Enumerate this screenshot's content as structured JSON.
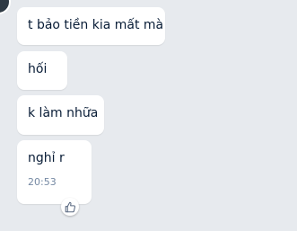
{
  "messages": [
    {
      "text": "t bảo tiền kia mất mà"
    },
    {
      "text": "hối"
    },
    {
      "text": "k làm nhữa"
    },
    {
      "text": "nghỉ r",
      "time": "20:53"
    }
  ],
  "icons": {
    "reaction": "thumbs-up-icon",
    "avatar": "avatar"
  }
}
